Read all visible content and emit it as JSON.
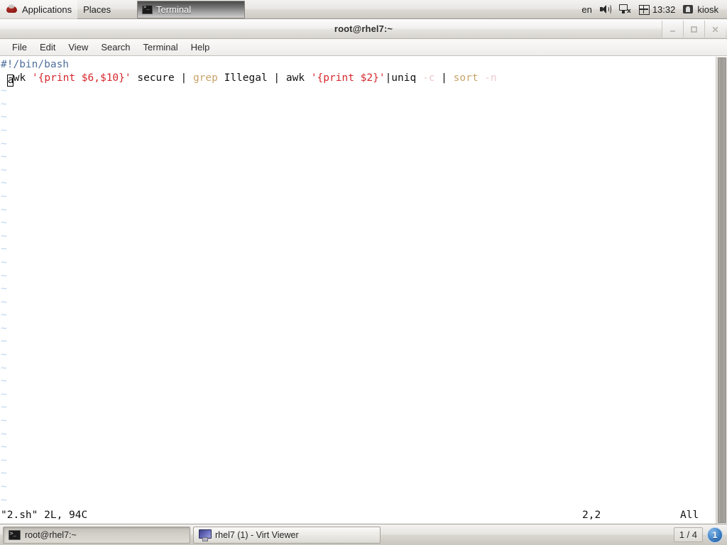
{
  "top_panel": {
    "logo_icon": "redhat-shadowman-icon",
    "applications_label": "Applications",
    "places_label": "Places",
    "window_button": {
      "label": "Terminal",
      "icon": "terminal-icon"
    },
    "keyboard_layout": "en",
    "volume_icon": "volume-icon",
    "network_icon": "network-disconnected-icon",
    "calendar_icon": "calendar-icon",
    "clock": "13:32",
    "user_icon": "user-session-icon",
    "user_label": "kiosk"
  },
  "terminal_window": {
    "title": "root@rhel7:~",
    "controls": {
      "minimize": "minimize-icon",
      "maximize": "maximize-icon",
      "close": "close-icon"
    },
    "menus": [
      "File",
      "Edit",
      "View",
      "Search",
      "Terminal",
      "Help"
    ]
  },
  "vim": {
    "lines": [
      {
        "tokens": [
          {
            "text": "#!/bin/bash",
            "style": "comment"
          }
        ]
      },
      {
        "tokens": [
          {
            "text": " ",
            "style": "normal"
          },
          {
            "text": "a",
            "style": "cursor"
          },
          {
            "text": "wk ",
            "style": "normal"
          },
          {
            "text": "'{print $6,$10}'",
            "style": "string"
          },
          {
            "text": " secure | ",
            "style": "normal"
          },
          {
            "text": "grep",
            "style": "keyword"
          },
          {
            "text": " Illegal | awk ",
            "style": "normal"
          },
          {
            "text": "'{print $2}'",
            "style": "string"
          },
          {
            "text": "|uniq ",
            "style": "normal"
          },
          {
            "text": "-c",
            "style": "option"
          },
          {
            "text": " | ",
            "style": "normal"
          },
          {
            "text": "sort",
            "style": "keyword"
          },
          {
            "text": " ",
            "style": "normal"
          },
          {
            "text": "-n",
            "style": "option"
          }
        ]
      }
    ],
    "empty_line_marker": "~",
    "empty_line_count": 32,
    "status": {
      "file_info": "\"2.sh\" 2L, 94C",
      "position": "2,2",
      "scroll": "All"
    },
    "colors": {
      "comment": "#4f6f9c",
      "string": "#d6272c",
      "keyword": "#c8a46a",
      "option": "#eec8cf",
      "normal": "#111111",
      "nontext": "#bcd4ee",
      "background": "#ffffff"
    }
  },
  "taskbar": {
    "windows": [
      {
        "label": "root@rhel7:~",
        "icon": "terminal-icon",
        "active": true
      },
      {
        "label": "rhel7 (1) - Virt Viewer",
        "icon": "monitor-icon",
        "active": false
      }
    ],
    "workspace_count": "1 / 4",
    "workspace_badge": "1"
  }
}
